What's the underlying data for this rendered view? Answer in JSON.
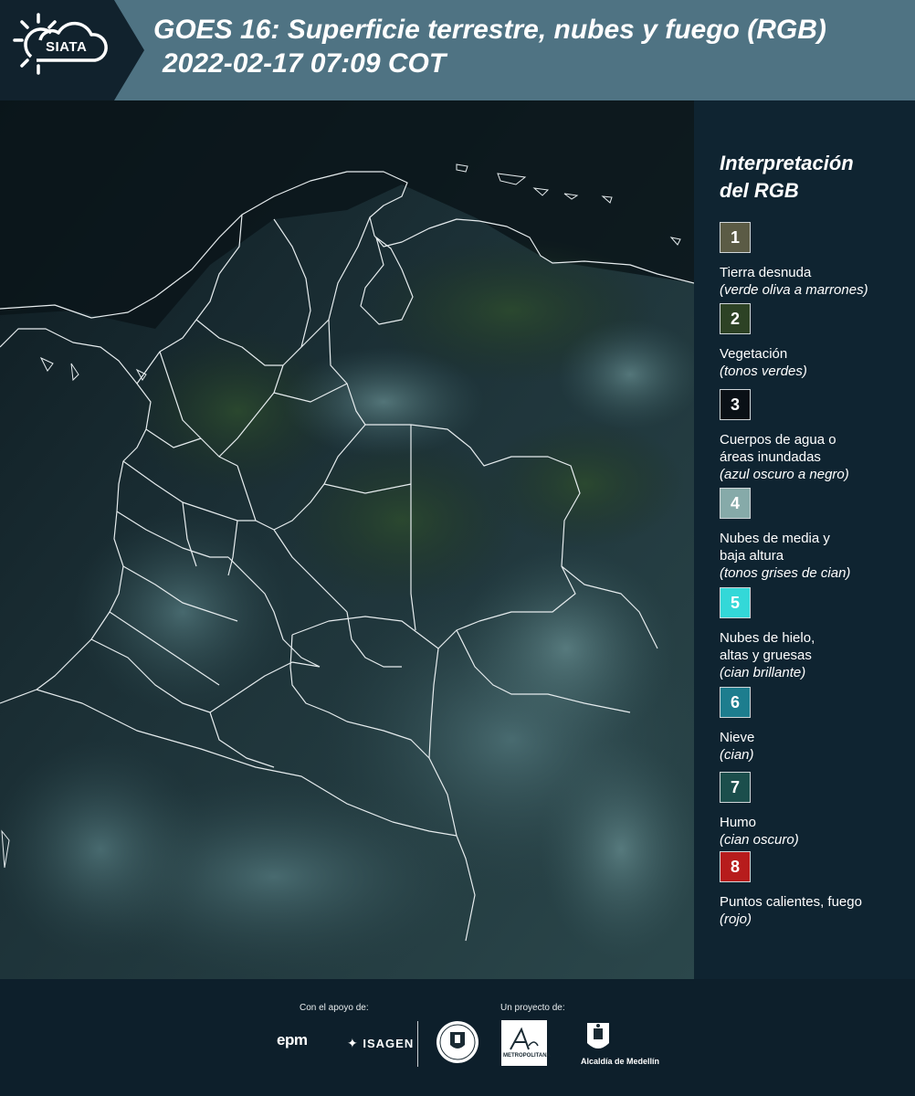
{
  "header": {
    "logo_text": "SIATA",
    "title_line1": "GOES 16: Superficie terrestre, nubes y fuego (RGB)",
    "title_line2": "2022-02-17 07:09 COT",
    "bg_color": "#4f7383"
  },
  "legend": {
    "title_line1": "Interpretación",
    "title_line2": "del RGB",
    "items": [
      {
        "number": "1",
        "color": "#5b5b45",
        "label_lines": [
          "Tierra desnuda"
        ],
        "desc": "(verde oliva a marrones)"
      },
      {
        "number": "2",
        "color": "#2d4225",
        "label_lines": [
          "Vegetación"
        ],
        "desc": "(tonos verdes)"
      },
      {
        "number": "3",
        "color": "#0a1016",
        "label_lines": [
          "Cuerpos de agua o",
          "áreas inundadas"
        ],
        "desc": "(azul oscuro a negro)"
      },
      {
        "number": "4",
        "color": "#86aaa9",
        "label_lines": [
          "Nubes de media y",
          "baja altura"
        ],
        "desc": "(tonos grises de cian)"
      },
      {
        "number": "5",
        "color": "#33d8d8",
        "label_lines": [
          "Nubes de hielo,",
          "altas y gruesas"
        ],
        "desc": "(cian brillante)"
      },
      {
        "number": "6",
        "color": "#1d7d8e",
        "label_lines": [
          "Nieve"
        ],
        "desc": "(cian)"
      },
      {
        "number": "7",
        "color": "#1b4e4c",
        "label_lines": [
          "Humo"
        ],
        "desc": "(cian oscuro)"
      },
      {
        "number": "8",
        "color": "#b71c1c",
        "label_lines": [
          "Puntos calientes, fuego"
        ],
        "desc": "(rojo)"
      }
    ]
  },
  "footer": {
    "support_label": "Con el apoyo de:",
    "project_label": "Un proyecto de:",
    "epm": "epm",
    "isagen": "ISAGEN",
    "area_sub": "METROPOLITANA",
    "alcaldia": "Alcaldía de Medellín"
  }
}
